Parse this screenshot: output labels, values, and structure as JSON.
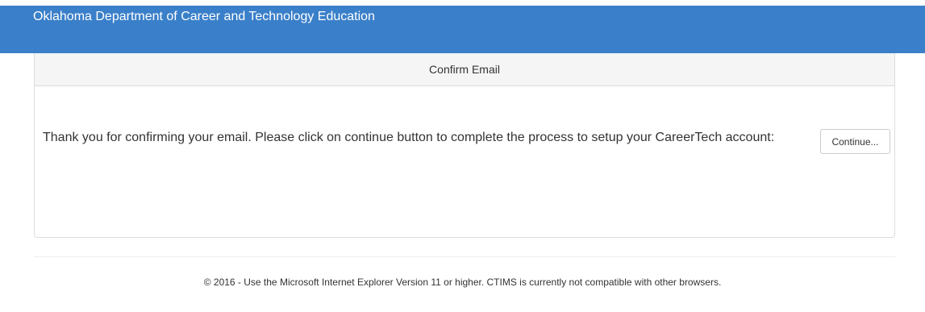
{
  "header": {
    "title": "Oklahoma Department of Career and Technology Education",
    "background_color": "#3a7fc9"
  },
  "panel": {
    "heading": "Confirm Email",
    "message": "Thank you for confirming your email. Please click on continue button to complete the process to setup your CareerTech account:",
    "continue_label": "Continue..."
  },
  "footer": {
    "text": "© 2016 - Use the Microsoft Internet Explorer Version 11 or higher. CTIMS is currently not compatible with other browsers."
  }
}
